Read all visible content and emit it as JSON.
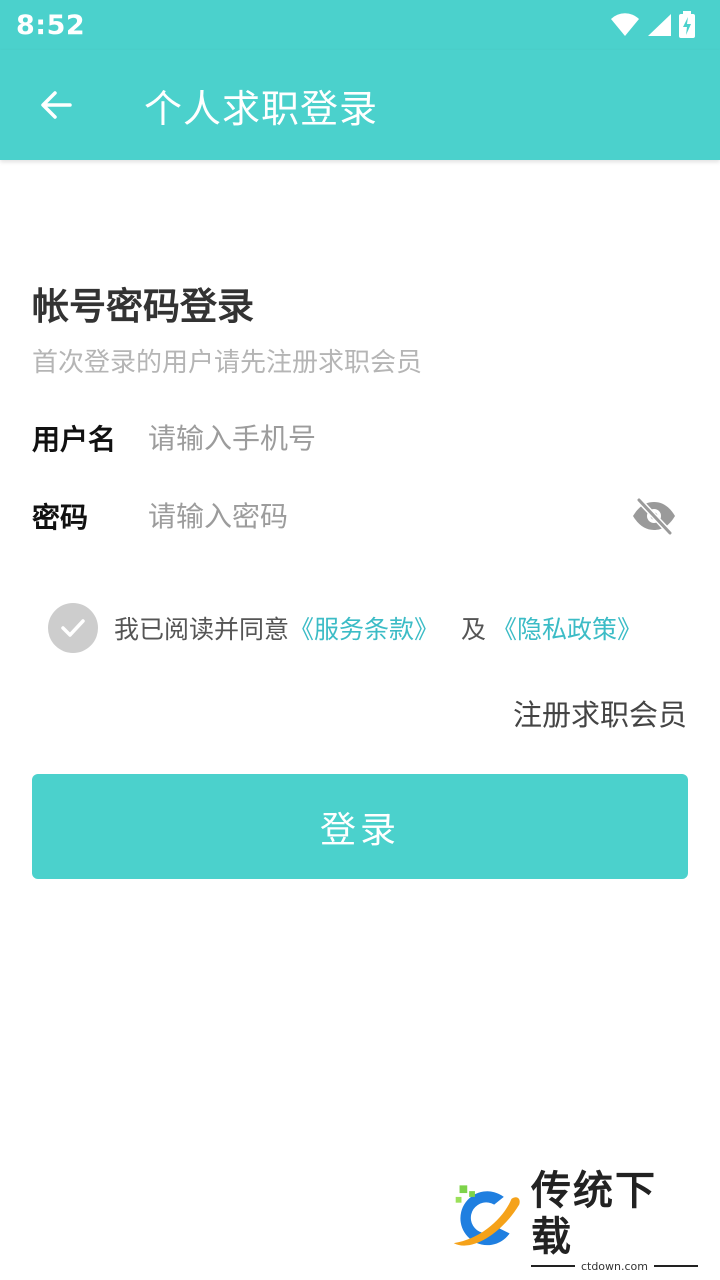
{
  "status_bar": {
    "time": "8:52"
  },
  "app_bar": {
    "title": "个人求职登录"
  },
  "login_form": {
    "heading": "帐号密码登录",
    "subheading": "首次登录的用户请先注册求职会员",
    "username": {
      "label": "用户名",
      "placeholder": "请输入手机号",
      "value": ""
    },
    "password": {
      "label": "密码",
      "placeholder": "请输入密码",
      "value": ""
    },
    "agreement": {
      "text": "我已阅读并同意",
      "terms_link": "《服务条款》",
      "conjunction": "及",
      "privacy_link": "《隐私政策》",
      "checked": false
    },
    "register_link": "注册求职会员",
    "login_button": "登录"
  },
  "watermark": {
    "name": "传统下载",
    "domain": "ctdown.com"
  },
  "colors": {
    "accent": "#4bd1cc",
    "link": "#3cbcc6",
    "checkbox": "#cdcdcd"
  }
}
